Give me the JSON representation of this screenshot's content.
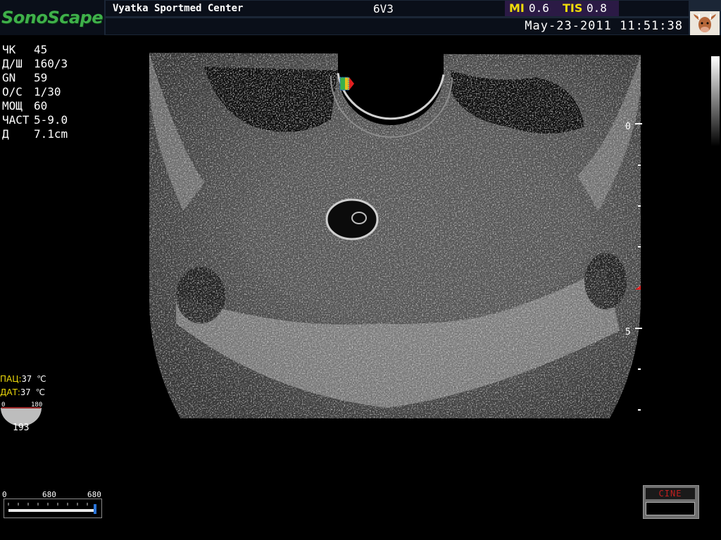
{
  "header": {
    "logo": "SonoScape",
    "hospital": "Vyatka Sportmed Center",
    "probe": "6V3",
    "mi_label": "MI",
    "mi_value": "0.6",
    "tis_label": "TIS",
    "tis_value": "0.8",
    "datetime": "May-23-2011 11:51:38",
    "avatar_icon": "cow-icon"
  },
  "params": [
    {
      "key": "ЧК",
      "value": "45"
    },
    {
      "key": "Д/Ш",
      "value": "160/3"
    },
    {
      "key": "GN",
      "value": "59"
    },
    {
      "key": "О/С",
      "value": "1/30"
    },
    {
      "key": "МОЩ",
      "value": "60"
    },
    {
      "key": "ЧАСТ",
      "value": "5-9.0"
    },
    {
      "key": "Д",
      "value": "7.1cm"
    }
  ],
  "depth_scale": {
    "label_top": "0",
    "label_mid": "5"
  },
  "temps": {
    "patient_label": "ПАЦ:",
    "patient_value": "37 ℃",
    "probe_label": "ДАТ:",
    "probe_value": "37 ℃"
  },
  "angle": {
    "min": "0",
    "max": "180",
    "value": "193"
  },
  "cine_scale": {
    "start": "0",
    "mid": "680",
    "end": "680",
    "position_fraction": 1.0
  },
  "cine_button": {
    "label": "CINE"
  },
  "colors": {
    "logo_green": "#3fb04a",
    "label_yellow": "#f0dc0a",
    "header_bg": "#0a0f19",
    "cine_red": "#c02020"
  }
}
